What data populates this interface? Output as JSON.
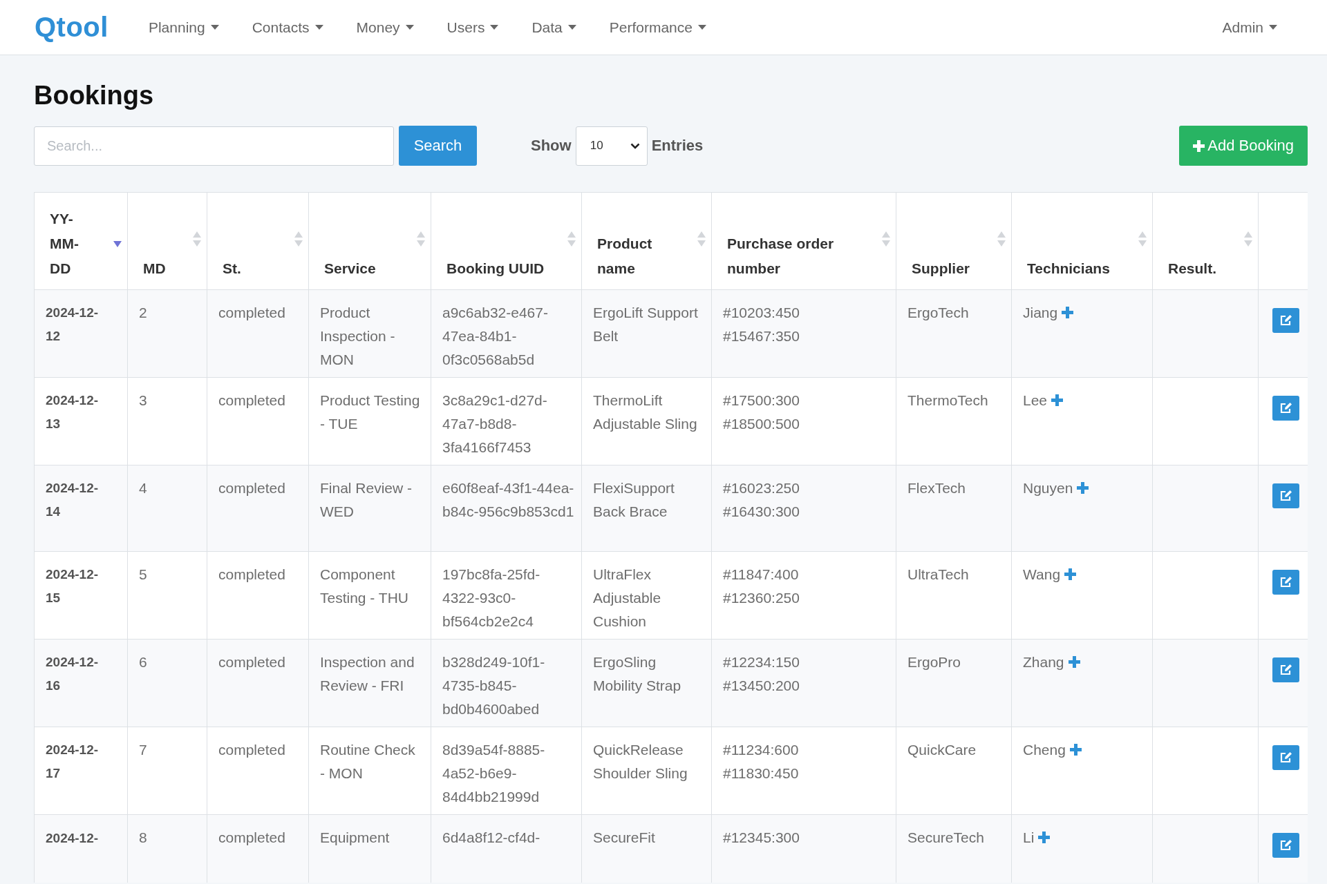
{
  "navbar": {
    "logo": "Qtool",
    "menus": [
      {
        "label": "Planning"
      },
      {
        "label": "Contacts"
      },
      {
        "label": "Money"
      },
      {
        "label": "Users"
      },
      {
        "label": "Data"
      },
      {
        "label": "Performance"
      }
    ],
    "user_menu": "Admin"
  },
  "page_title": "Bookings",
  "search": {
    "placeholder": "Search...",
    "button": "Search"
  },
  "page_size": {
    "label": "Show",
    "value": "10",
    "suffix": "Entries"
  },
  "add_button": "Add Booking",
  "table": {
    "columns": [
      {
        "label": "YY-MM-DD",
        "sorted": true
      },
      {
        "label": "MD",
        "sorted": false
      },
      {
        "label": "St.",
        "sorted": false
      },
      {
        "label": "Service",
        "sorted": false
      },
      {
        "label": "Booking UUID",
        "sorted": false
      },
      {
        "label": "Product name",
        "sorted": false
      },
      {
        "label": "Purchase order number",
        "sorted": false
      },
      {
        "label": "Supplier",
        "sorted": false
      },
      {
        "label": "Technicians",
        "sorted": false
      },
      {
        "label": "Result.",
        "sorted": false
      }
    ],
    "rows": [
      {
        "date": "2024-12-12",
        "md": "2",
        "status": "completed",
        "service": "Product Inspection - MON",
        "booking_uuid": "a9c6ab32-e467-47ea-84b1-0f3c0568ab5d",
        "product_name": "ErgoLift Support Belt",
        "purchase_orders": [
          "#10203:450",
          "#15467:350"
        ],
        "supplier": "ErgoTech",
        "technician": "Jiang"
      },
      {
        "date": "2024-12-13",
        "md": "3",
        "status": "completed",
        "service": "Product Testing - TUE",
        "booking_uuid": "3c8a29c1-d27d-47a7-b8d8-3fa4166f7453",
        "product_name": "ThermoLift Adjustable Sling",
        "purchase_orders": [
          "#17500:300",
          "#18500:500"
        ],
        "supplier": "ThermoTech",
        "technician": "Lee"
      },
      {
        "date": "2024-12-14",
        "md": "4",
        "status": "completed",
        "service": "Final Review - WED",
        "booking_uuid": "e60f8eaf-43f1-44ea-b84c-956c9b853cd1",
        "product_name": "FlexiSupport Back Brace",
        "purchase_orders": [
          "#16023:250",
          "#16430:300"
        ],
        "supplier": "FlexTech",
        "technician": "Nguyen"
      },
      {
        "date": "2024-12-15",
        "md": "5",
        "status": "completed",
        "service": "Component Testing - THU",
        "booking_uuid": "197bc8fa-25fd-4322-93c0-bf564cb2e2c4",
        "product_name": "UltraFlex Adjustable Cushion",
        "purchase_orders": [
          "#11847:400",
          "#12360:250"
        ],
        "supplier": "UltraTech",
        "technician": "Wang"
      },
      {
        "date": "2024-12-16",
        "md": "6",
        "status": "completed",
        "service": "Inspection and Review - FRI",
        "booking_uuid": "b328d249-10f1-4735-b845-bd0b4600abed",
        "product_name": "ErgoSling Mobility Strap",
        "purchase_orders": [
          "#12234:150",
          "#13450:200"
        ],
        "supplier": "ErgoPro",
        "technician": "Zhang"
      },
      {
        "date": "2024-12-17",
        "md": "7",
        "status": "completed",
        "service": "Routine Check - MON",
        "booking_uuid": "8d39a54f-8885-4a52-b6e9-84d4bb21999d",
        "product_name": "QuickRelease Shoulder Sling",
        "purchase_orders": [
          "#11234:600",
          "#11830:450"
        ],
        "supplier": "QuickCare",
        "technician": "Cheng"
      },
      {
        "date": "2024-12-",
        "md": "8",
        "status": "completed",
        "service": "Equipment",
        "booking_uuid": "6d4a8f12-cf4d-",
        "product_name": "SecureFit",
        "purchase_orders": [
          "#12345:300"
        ],
        "supplier": "SecureTech",
        "technician": "Li"
      }
    ]
  }
}
